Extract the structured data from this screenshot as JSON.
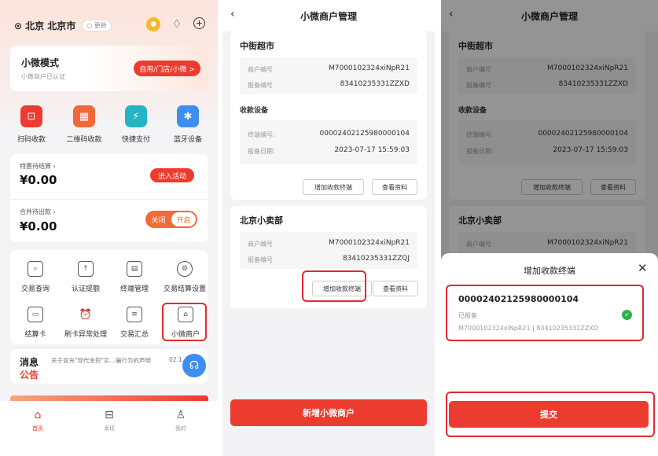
{
  "panel1": {
    "location": "北京 北京市",
    "update_label": "更新",
    "mode_title": "小微模式",
    "mode_sub": "小微商户已认证",
    "mode_btn": "自用/门店/小微 >",
    "services": [
      {
        "label": "扫码收款",
        "color": "#ec3b2f",
        "icon": "⊡"
      },
      {
        "label": "二维码收款",
        "color": "#f0693b",
        "icon": "▦"
      },
      {
        "label": "快捷支付",
        "color": "#24b5c4",
        "icon": "⚡"
      },
      {
        "label": "蓝牙设备",
        "color": "#3d8ef0",
        "icon": "✱"
      }
    ],
    "pending_label": "特惠待结算 ›",
    "pending_amount": "¥0.00",
    "activity_btn": "进入活动",
    "merge_label": "合并待出款 ›",
    "merge_amount": "¥0.00",
    "toggle_off": "关闭",
    "toggle_on": "开启",
    "grid": [
      "交易查询",
      "认证提额",
      "终端管理",
      "交易结算设置",
      "结算卡",
      "刷卡异常处理",
      "交易汇总",
      "小微商户"
    ],
    "notice_title": "消息",
    "notice_title2": "公告",
    "notice_text": "关于冒充\"现代金控\"实…骗行为的声明",
    "notice_date": "02.1",
    "tabs": [
      "首页",
      "发现",
      "我的"
    ]
  },
  "panel2": {
    "title": "小微商户管理",
    "merchants": [
      {
        "name": "中街超市",
        "merchant_no_label": "商户编号",
        "merchant_no": "M7000102324xiNpR21",
        "report_no_label": "报备编号",
        "report_no": "83410235331ZZXD",
        "device_section": "收款设备",
        "terminal_label": "终端编号:",
        "terminal_no": "00002402125980000104",
        "date_label": "报备日期:",
        "date": "2023-07-17 15:59:03",
        "add_btn": "增加收款终端",
        "view_btn": "查看资料"
      },
      {
        "name": "北京小卖部",
        "merchant_no_label": "商户编号",
        "merchant_no": "M7000102324xiNpR21",
        "report_no_label": "报备编号",
        "report_no": "83410235331ZZQJ",
        "add_btn": "增加收款终端",
        "view_btn": "查看资料"
      }
    ],
    "add_merchant_btn": "新增小微商户"
  },
  "panel3": {
    "title": "小微商户管理",
    "merchant_name": "中街超市",
    "merchant_no_label": "商户编号",
    "merchant_no": "M7000102324xiNpR21",
    "report_no_label": "报备编号",
    "report_no": "83410235331ZZXD",
    "device_section": "收款设备",
    "terminal_label": "终端编号:",
    "terminal_no": "00002402125980000104",
    "date_label": "报备日期:",
    "date": "2023-07-17 15:59:03",
    "add_btn": "增加收款终端",
    "view_btn": "查看资料",
    "merchant2_name": "北京小卖部",
    "merchant2_no_label": "商户编号",
    "merchant2_no": "M7000102324xiNpR21",
    "sheet_title": "增加收款终端",
    "terminal_item_no": "00002402125980000104",
    "terminal_item_status": "已报备",
    "terminal_item_detail": "M7000102324xiNpR21 | 83410235331ZZXD",
    "submit_btn": "提交"
  }
}
